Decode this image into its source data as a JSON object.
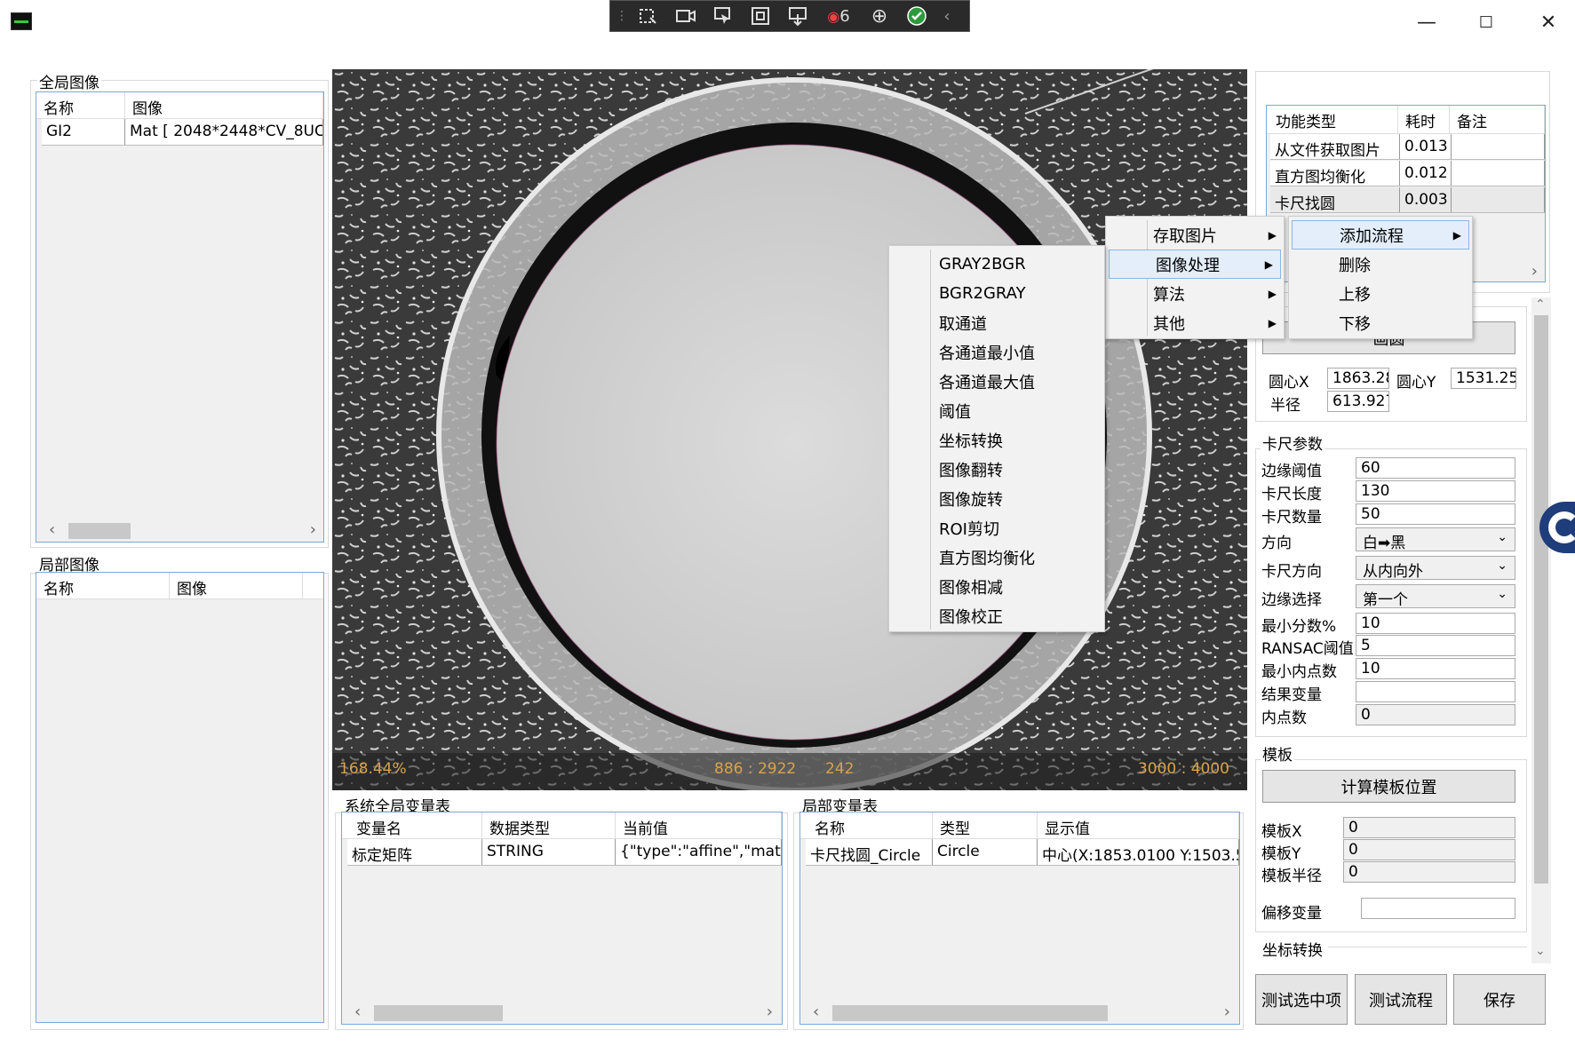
{
  "window": {
    "minimize": "—",
    "maximize": "☐",
    "close": "✕"
  },
  "toolbar": {
    "record_count": "6"
  },
  "global_images": {
    "title": "全局图像",
    "columns": [
      "名称",
      "图像"
    ],
    "rows": [
      [
        "GI2",
        "Mat [ 2048*2448*CV_8UC"
      ]
    ]
  },
  "local_images": {
    "title": "局部图像",
    "columns": [
      "名称",
      "图像"
    ]
  },
  "viewer": {
    "zoom": "168.44%",
    "cursor": "886 : 2922",
    "pixel": "242",
    "size": "3000 : 4000"
  },
  "sys_vars": {
    "title": "系统全局变量表",
    "columns": [
      "变量名",
      "数据类型",
      "当前值"
    ],
    "rows": [
      [
        "标定矩阵",
        "STRING",
        "{\"type\":\"affine\",\"matr"
      ]
    ]
  },
  "local_vars": {
    "title": "局部变量表",
    "columns": [
      "名称",
      "类型",
      "显示值"
    ],
    "rows": [
      [
        "卡尺找圆_Circle",
        "Circle",
        "中心(X:1853.0100 Y:1503.5"
      ]
    ]
  },
  "flow": {
    "columns": [
      "功能类型",
      "耗时",
      "备注"
    ],
    "rows": [
      [
        "从文件获取图片",
        "0.013",
        ""
      ],
      [
        "直方图均衡化",
        "0.012",
        ""
      ],
      [
        "卡尺找圆",
        "0.003",
        ""
      ]
    ]
  },
  "menu_main": [
    "存取图片",
    "图像处理",
    "算法",
    "其他"
  ],
  "menu_actions": [
    "添加流程",
    "删除",
    "上移",
    "下移"
  ],
  "menu_image": [
    "GRAY2BGR",
    "BGR2GRAY",
    "取通道",
    "各通道最小值",
    "各通道最大值",
    "阈值",
    "坐标转换",
    "图像翻转",
    "图像旋转",
    "ROI剪切",
    "直方图均衡化",
    "图像相减",
    "图像校正"
  ],
  "circle": {
    "btn": "画圆",
    "cx_label": "圆心X",
    "cx": "1863.28",
    "cy_label": "圆心Y",
    "cy": "1531.25",
    "r_label": "半径",
    "r": "613.927"
  },
  "caliper": {
    "title": "卡尺参数",
    "edge_threshold_label": "边缘阈值",
    "edge_threshold": "60",
    "length_label": "卡尺长度",
    "length": "130",
    "count_label": "卡尺数量",
    "count": "50",
    "direction_label": "方向",
    "direction": "白➡黑",
    "cal_dir_label": "卡尺方向",
    "cal_dir": "从内向外",
    "edge_sel_label": "边缘选择",
    "edge_sel": "第一个",
    "min_score_label": "最小分数%",
    "min_score": "10",
    "ransac_label": "RANSAC阈值",
    "ransac": "5",
    "min_inliers_label": "最小内点数",
    "min_inliers": "10",
    "result_var_label": "结果变量",
    "result_var": "",
    "inliers_label": "内点数",
    "inliers": "0"
  },
  "template": {
    "title": "模板",
    "calc_btn": "计算模板位置",
    "x_label": "模板X",
    "x": "0",
    "y_label": "模板Y",
    "y": "0",
    "r_label": "模板半径",
    "r": "0",
    "offset_label": "偏移变量",
    "offset": ""
  },
  "coord": {
    "title": "坐标转换"
  },
  "buttons": {
    "test_selected": "测试选中项",
    "test_flow": "测试流程",
    "save": "保存"
  }
}
